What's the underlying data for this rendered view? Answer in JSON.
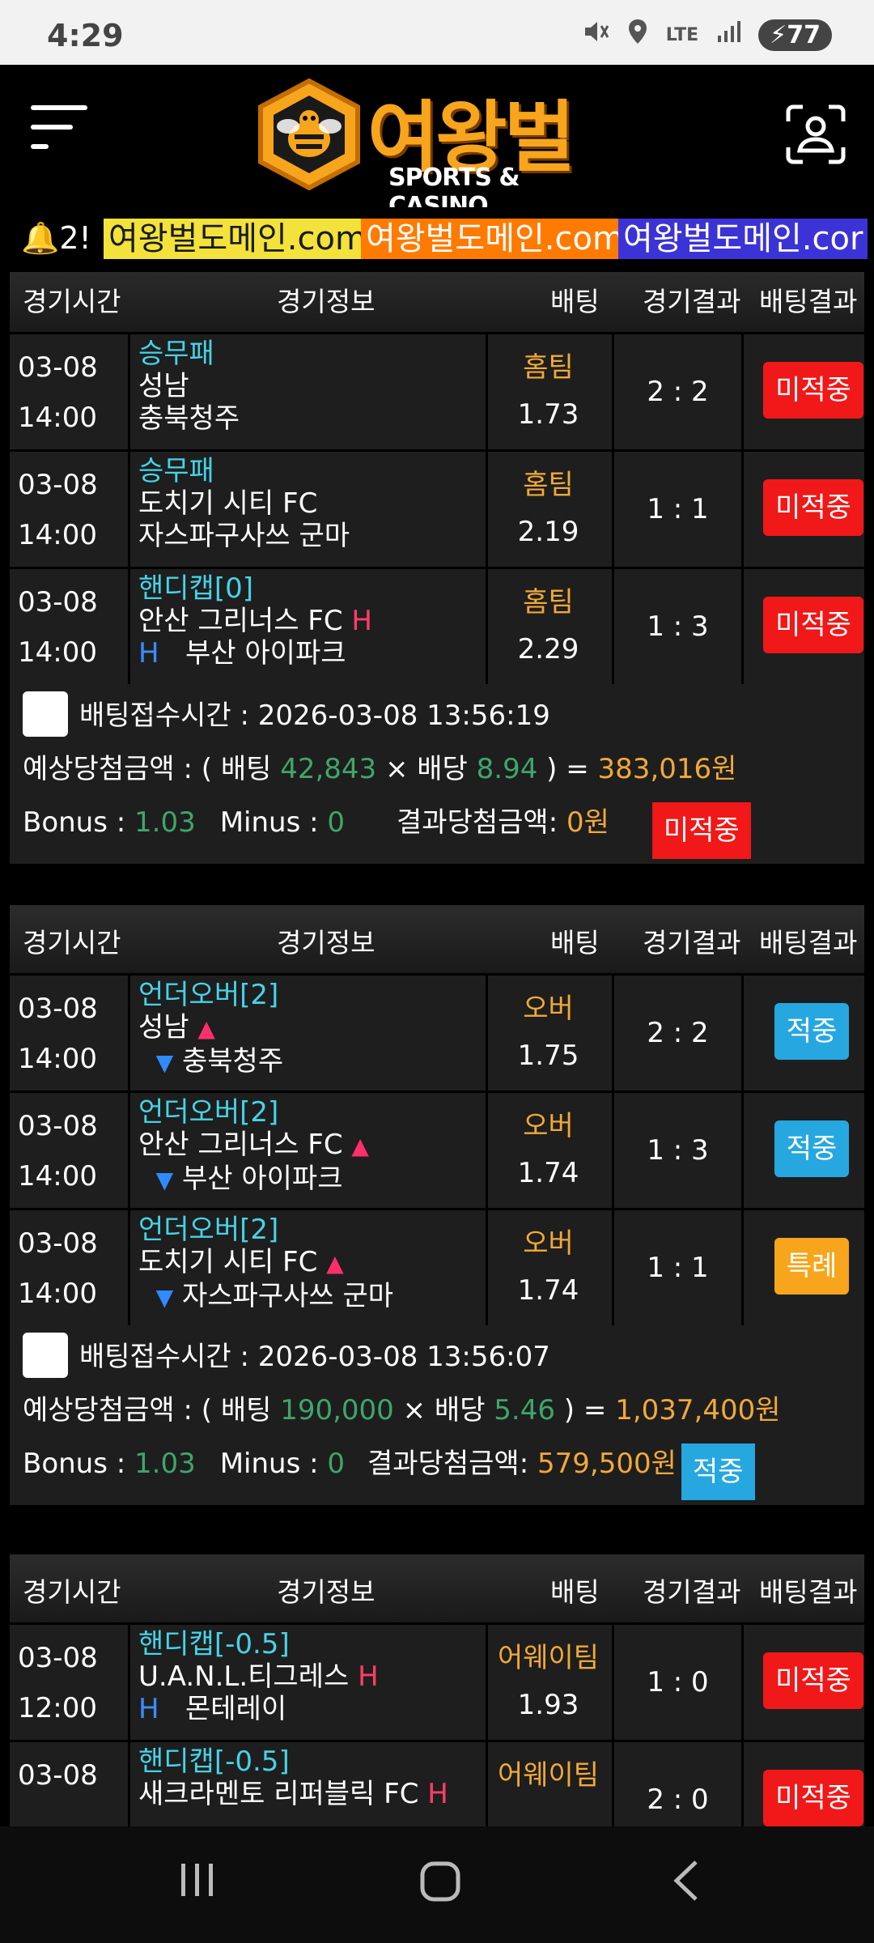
{
  "status": {
    "time": "4:29",
    "network": "LTE",
    "battery": "77"
  },
  "header": {
    "brand": "여왕벌",
    "sub": "SPORTS & CASINO"
  },
  "ticker": {
    "prefix": "2!",
    "items": [
      {
        "text": "여왕벌도메인.com",
        "bg": "#f2e23b",
        "color": "#1a1a1a"
      },
      {
        "text": "여왕벌도메인.com",
        "bg": "#ff7a00",
        "color": "#ffffff"
      },
      {
        "text": "여왕벌도메인.cor",
        "bg": "#3b33d6",
        "color": "#ffffff"
      }
    ]
  },
  "table_header": {
    "time": "경기시간",
    "info": "경기정보",
    "bet": "배팅",
    "result": "경기결과",
    "bet_result": "배팅결과"
  },
  "slips": [
    {
      "rows": [
        {
          "date": "03-08",
          "time": "14:00",
          "market": "승무패",
          "home": "성남",
          "away": "충북청주",
          "pick": "홈팀",
          "odds": "1.73",
          "score": "2 : 2",
          "status": "미적중",
          "kind": "miss"
        },
        {
          "date": "03-08",
          "time": "14:00",
          "market": "승무패",
          "home": "도치기 시티 FC",
          "away": "자스파구사쓰 군마",
          "pick": "홈팀",
          "odds": "2.19",
          "score": "1 : 1",
          "status": "미적중",
          "kind": "miss"
        },
        {
          "date": "03-08",
          "time": "14:00",
          "market": "핸디캡[0]",
          "home": "안산 그리너스 FC",
          "away": "부산 아이파크",
          "home_tag": "H",
          "away_tag": "H",
          "pick": "홈팀",
          "odds": "2.29",
          "score": "1 : 3",
          "status": "미적중",
          "kind": "miss"
        }
      ],
      "received_label": "배팅접수시간 : 2026-03-08 13:56:19",
      "expected_prefix": "예상당첨금액 : ( 배팅 ",
      "stake": "42,843",
      "x": " × ",
      "odds_label": "배당 ",
      "total_odds": "8.94",
      "close": " ) = ",
      "expected": "383,016원",
      "bonus_label": "Bonus : ",
      "bonus": "1.03",
      "minus_label": "Minus : ",
      "minus": "0",
      "payout_label": "결과당첨금액: ",
      "payout": "0원",
      "status": "미적중"
    },
    {
      "rows": [
        {
          "date": "03-08",
          "time": "14:00",
          "market": "언더오버[2]",
          "home": "성남",
          "away": "충북청주",
          "pick": "오버",
          "odds": "1.75",
          "score": "2 : 2",
          "status": "적중",
          "kind": "hit"
        },
        {
          "date": "03-08",
          "time": "14:00",
          "market": "언더오버[2]",
          "home": "안산 그리너스 FC",
          "away": "부산 아이파크",
          "pick": "오버",
          "odds": "1.74",
          "score": "1 : 3",
          "status": "적중",
          "kind": "hit"
        },
        {
          "date": "03-08",
          "time": "14:00",
          "market": "언더오버[2]",
          "home": "도치기 시티 FC",
          "away": "자스파구사쓰 군마",
          "pick": "오버",
          "odds": "1.74",
          "score": "1 : 1",
          "status": "특례",
          "kind": "spec"
        }
      ],
      "received_label": "배팅접수시간 : 2026-03-08 13:56:07",
      "expected_prefix": "예상당첨금액 : ( 배팅 ",
      "stake": "190,000",
      "x": " × ",
      "odds_label": "배당 ",
      "total_odds": "5.46",
      "close": " ) = ",
      "expected": "1,037,400원",
      "bonus_label": "Bonus : ",
      "bonus": "1.03",
      "minus_label": "Minus : ",
      "minus": "0",
      "payout_label": "결과당첨금액: ",
      "payout": "579,500원",
      "status": "적중"
    },
    {
      "rows": [
        {
          "date": "03-08",
          "time": "12:00",
          "market": "핸디캡[-0.5]",
          "home": "U.A.N.L.티그레스",
          "away": "몬테레이",
          "home_tag": "H",
          "away_tag": "H",
          "pick": "어웨이팀",
          "odds": "1.93",
          "score": "1 : 0",
          "status": "미적중",
          "kind": "miss"
        },
        {
          "date": "03-08",
          "time": "",
          "market": "핸디캡[-0.5]",
          "home": "새크라멘토 리퍼블릭 FC",
          "away": "",
          "home_tag": "H",
          "pick": "어웨이팀",
          "odds": "",
          "score": "2 : 0",
          "status": "미적중",
          "kind": "miss"
        }
      ]
    }
  ]
}
